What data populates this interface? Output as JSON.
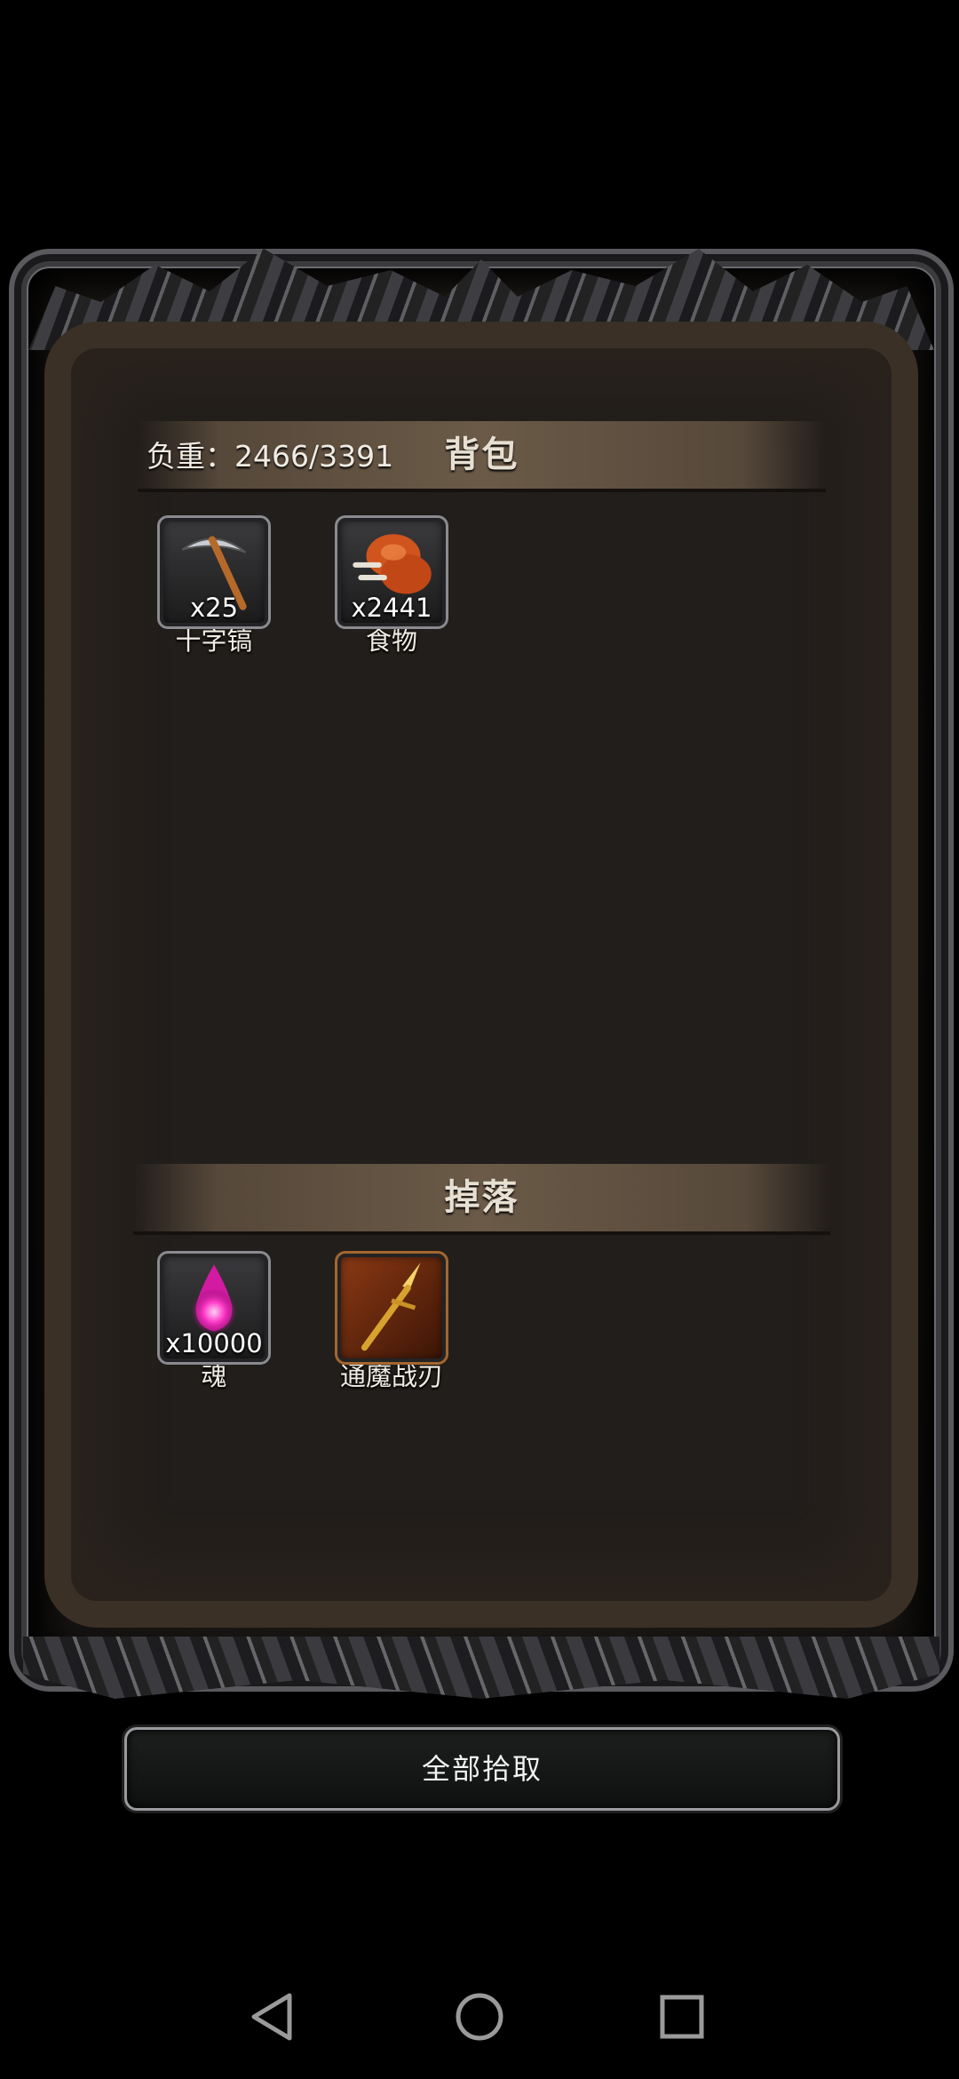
{
  "backpack": {
    "weight_label": "负重：2466/3391",
    "title": "背包",
    "items": [
      {
        "name": "十字镐",
        "count": "x25",
        "icon": "pickaxe-icon"
      },
      {
        "name": "食物",
        "count": "x2441",
        "icon": "chicken-leg-icon"
      }
    ]
  },
  "drops": {
    "title": "掉落",
    "items": [
      {
        "name": "魂",
        "count": "x10000",
        "icon": "soul-flame-icon"
      },
      {
        "name": "通魔战刃",
        "count": "",
        "icon": "golden-spear-icon"
      }
    ]
  },
  "collect_all_label": "全部拾取",
  "nav": [
    "back-icon",
    "home-icon",
    "recents-icon"
  ],
  "colors": {
    "accent": "#6a5a47",
    "panel": "#221e1b",
    "frame": "#5a5a5e"
  }
}
